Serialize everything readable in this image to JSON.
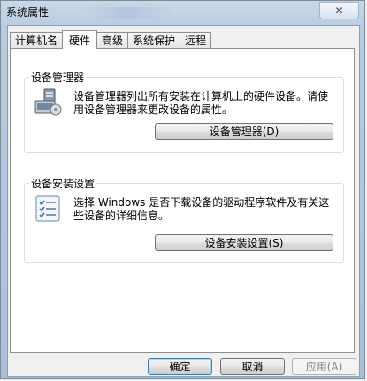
{
  "window": {
    "title": "系统属性",
    "close_symbol": "✕"
  },
  "tabs": [
    {
      "label": "计算机名",
      "active": false
    },
    {
      "label": "硬件",
      "active": true
    },
    {
      "label": "高级",
      "active": false
    },
    {
      "label": "系统保护",
      "active": false
    },
    {
      "label": "远程",
      "active": false
    }
  ],
  "device_manager": {
    "title": "设备管理器",
    "description": "设备管理器列出所有安装在计算机上的硬件设备。请使用设备管理器来更改设备的属性。",
    "button_label": "设备管理器(D)",
    "icon": "device-manager-icon"
  },
  "device_installation": {
    "title": "设备安装设置",
    "description": "选择 Windows 是否下载设备的驱动程序软件及有关这些设备的详细信息。",
    "button_label": "设备安装设置(S)",
    "icon": "checklist-icon"
  },
  "footer": {
    "ok_label": "确定",
    "cancel_label": "取消",
    "apply_label": "应用(A)"
  }
}
